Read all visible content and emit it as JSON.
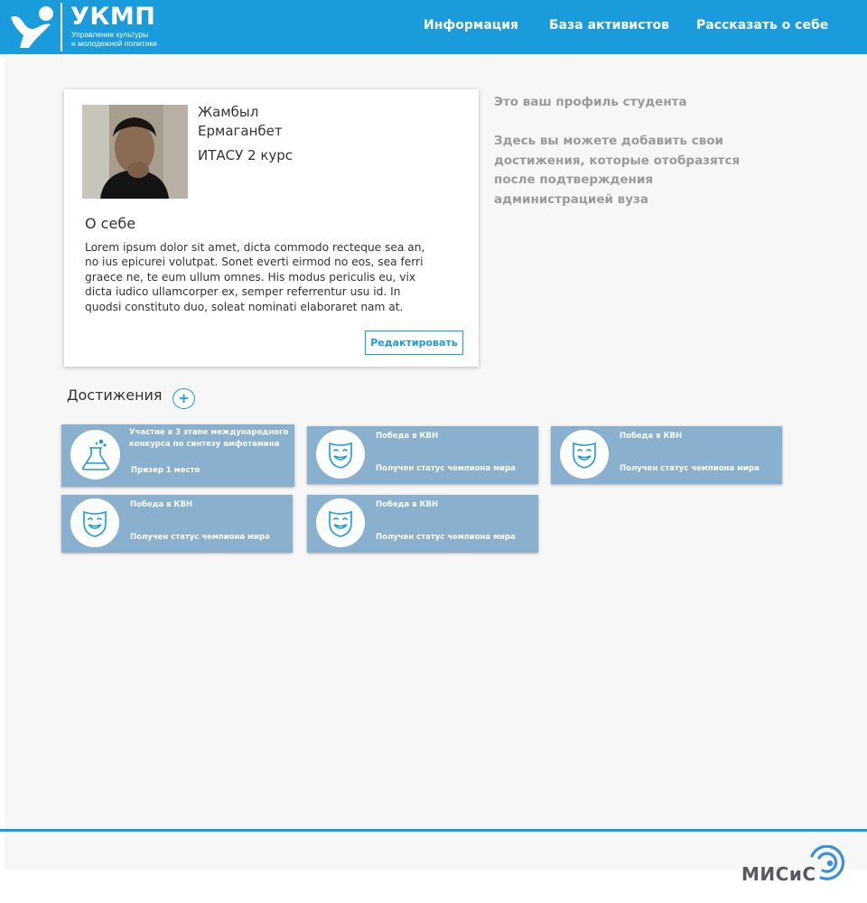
{
  "header": {
    "logo_title": "УКМП",
    "logo_subtitle_line1": "Управление культуры",
    "logo_subtitle_line2": "и молодежной политики",
    "nav": [
      "Информация",
      "База активистов",
      "Рассказать о себе"
    ],
    "background": "#1a9bdc"
  },
  "profile": {
    "first_name": "Жамбыл",
    "last_name": "Ермаганбет",
    "group": "ИТАСУ 2 курс",
    "about_title": "О себе",
    "about_text": "Lorem ipsum dolor sit amet, dicta commodo recteque sea an, no ius epicurei volutpat. Sonet everti eirmod no eos, sea ferri graece ne, te eum ullum omnes. His modus periculis eu, vix dicta iudico ullamcorper ex, semper referrentur usu id. In quodsi constituto duo, soleat nominati elaboraret nam at.",
    "edit_label": "Редактировать"
  },
  "info": {
    "line1": "Это ваш профиль студента",
    "line2": "Здесь вы можете добавить свои достижения, которые отобразятся после подтверждения администрацией вуза"
  },
  "achievements": {
    "title": "Достижения",
    "add_label": "+",
    "items": [
      {
        "icon": "flask-icon",
        "title": "Участие в 3 этапе международного конкурса по синтезу амфетамина",
        "subtitle": "Призер 1 место"
      },
      {
        "icon": "theater-mask-icon",
        "title": "Победа в КВН",
        "subtitle": "Получен статус чемпиона мира"
      },
      {
        "icon": "theater-mask-icon",
        "title": "Победа в КВН",
        "subtitle": "Получен статус чемпиона мира"
      },
      {
        "icon": "theater-mask-icon",
        "title": "Победа в КВН",
        "subtitle": "Получен статус чемпиона мира"
      },
      {
        "icon": "theater-mask-icon",
        "title": "Победа в КВН",
        "subtitle": "Получен статус чемпиона мира"
      }
    ],
    "card_color": "#8ab0cf",
    "icon_color": "#1a9bdc"
  },
  "footer": {
    "logo_text": "МИСиС"
  }
}
